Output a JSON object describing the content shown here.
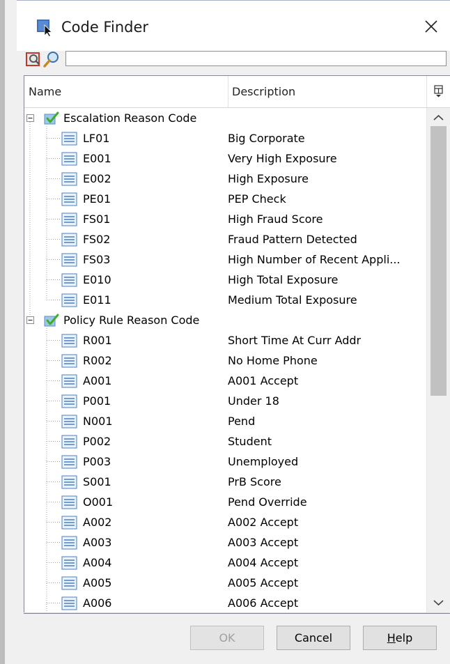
{
  "window": {
    "title": "Code Finder",
    "close_icon": "close-icon",
    "app_icon": "code-finder-app-icon"
  },
  "toolbar": {
    "find_icon": "find-in-list-icon",
    "search_icon": "magnifier-icon",
    "search_value": "",
    "search_placeholder": ""
  },
  "columns": {
    "name": "Name",
    "description": "Description",
    "menu_icon": "column-chooser-icon"
  },
  "groups": [
    {
      "label": "Escalation Reason Code",
      "items": [
        {
          "code": "LF01",
          "description": "Big Corporate"
        },
        {
          "code": "E001",
          "description": "Very High Exposure"
        },
        {
          "code": "E002",
          "description": "High Exposure"
        },
        {
          "code": "PE01",
          "description": "PEP Check"
        },
        {
          "code": "FS01",
          "description": "High Fraud Score"
        },
        {
          "code": "FS02",
          "description": "Fraud Pattern Detected"
        },
        {
          "code": "FS03",
          "description": "High Number of Recent Appli..."
        },
        {
          "code": "E010",
          "description": "High Total Exposure"
        },
        {
          "code": "E011",
          "description": "Medium Total Exposure"
        }
      ]
    },
    {
      "label": "Policy Rule Reason Code",
      "items": [
        {
          "code": "R001",
          "description": "Short Time At Curr Addr"
        },
        {
          "code": "R002",
          "description": "No Home Phone"
        },
        {
          "code": "A001",
          "description": "A001 Accept"
        },
        {
          "code": "P001",
          "description": "Under 18"
        },
        {
          "code": "N001",
          "description": "Pend"
        },
        {
          "code": "P002",
          "description": "Student"
        },
        {
          "code": "P003",
          "description": "Unemployed"
        },
        {
          "code": "S001",
          "description": "PrB Score"
        },
        {
          "code": "O001",
          "description": "Pend Override"
        },
        {
          "code": "A002",
          "description": "A002 Accept"
        },
        {
          "code": "A003",
          "description": "A003 Accept"
        },
        {
          "code": "A004",
          "description": "A004 Accept"
        },
        {
          "code": "A005",
          "description": "A005 Accept"
        },
        {
          "code": "A006",
          "description": "A006 Accept"
        }
      ]
    }
  ],
  "buttons": {
    "ok": "OK",
    "cancel": "Cancel",
    "help_prefix": "H",
    "help_rest": "elp"
  },
  "scrollbar": {
    "position_fraction": 0.0,
    "visible_fraction": 0.53
  },
  "colors": {
    "check_green": "#3fae2a",
    "list_icon_blue": "#4a7fc1",
    "disabled_text": "#a0a0a0"
  }
}
